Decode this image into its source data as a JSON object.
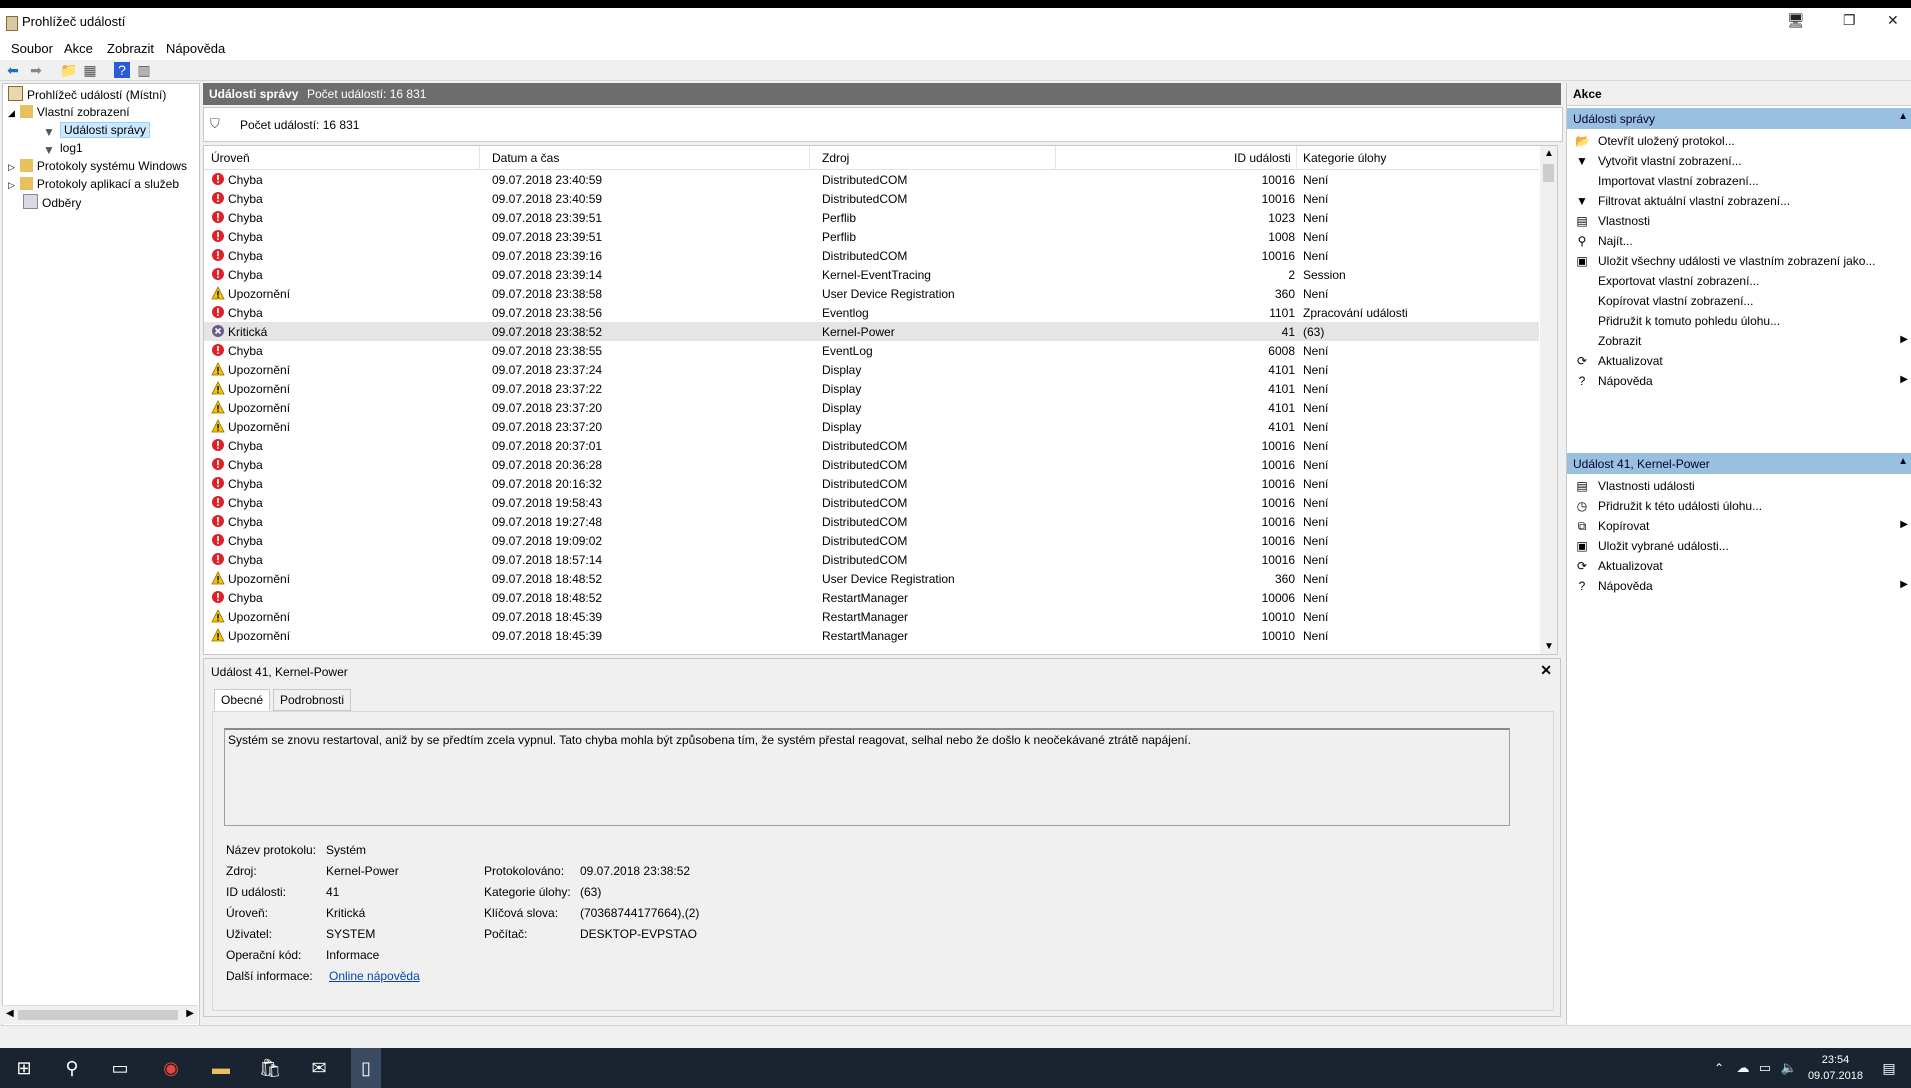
{
  "window": {
    "title": "Prohlížeč událostí"
  },
  "menu": [
    "Soubor",
    "Akce",
    "Zobrazit",
    "Nápověda"
  ],
  "tree": {
    "root": "Prohlížeč událostí (Místní)",
    "custom_views": "Vlastní zobrazení",
    "admin_events": "Události správy",
    "log1": "log1",
    "windows_logs": "Protokoly systému Windows",
    "app_logs": "Protokoly aplikací a služeb",
    "subscriptions": "Odběry"
  },
  "center_header": {
    "title": "Události správy",
    "count": "Počet událostí: 16 831"
  },
  "filter_text": "Počet událostí: 16 831",
  "columns": [
    "Úroveň",
    "Datum a čas",
    "Zdroj",
    "ID události",
    "Kategorie úlohy"
  ],
  "events": [
    {
      "level": "Chyba",
      "type": "error",
      "date": "09.07.2018 23:40:59",
      "source": "DistributedCOM",
      "id": "10016",
      "cat": "Není"
    },
    {
      "level": "Chyba",
      "type": "error",
      "date": "09.07.2018 23:40:59",
      "source": "DistributedCOM",
      "id": "10016",
      "cat": "Není"
    },
    {
      "level": "Chyba",
      "type": "error",
      "date": "09.07.2018 23:39:51",
      "source": "Perflib",
      "id": "1023",
      "cat": "Není"
    },
    {
      "level": "Chyba",
      "type": "error",
      "date": "09.07.2018 23:39:51",
      "source": "Perflib",
      "id": "1008",
      "cat": "Není"
    },
    {
      "level": "Chyba",
      "type": "error",
      "date": "09.07.2018 23:39:16",
      "source": "DistributedCOM",
      "id": "10016",
      "cat": "Není"
    },
    {
      "level": "Chyba",
      "type": "error",
      "date": "09.07.2018 23:39:14",
      "source": "Kernel-EventTracing",
      "id": "2",
      "cat": "Session"
    },
    {
      "level": "Upozornění",
      "type": "warning",
      "date": "09.07.2018 23:38:58",
      "source": "User Device Registration",
      "id": "360",
      "cat": "Není"
    },
    {
      "level": "Chyba",
      "type": "error",
      "date": "09.07.2018 23:38:56",
      "source": "Eventlog",
      "id": "1101",
      "cat": "Zpracování události"
    },
    {
      "level": "Kritická",
      "type": "critical",
      "date": "09.07.2018 23:38:52",
      "source": "Kernel-Power",
      "id": "41",
      "cat": "(63)"
    },
    {
      "level": "Chyba",
      "type": "error",
      "date": "09.07.2018 23:38:55",
      "source": "EventLog",
      "id": "6008",
      "cat": "Není"
    },
    {
      "level": "Upozornění",
      "type": "warning",
      "date": "09.07.2018 23:37:24",
      "source": "Display",
      "id": "4101",
      "cat": "Není"
    },
    {
      "level": "Upozornění",
      "type": "warning",
      "date": "09.07.2018 23:37:22",
      "source": "Display",
      "id": "4101",
      "cat": "Není"
    },
    {
      "level": "Upozornění",
      "type": "warning",
      "date": "09.07.2018 23:37:20",
      "source": "Display",
      "id": "4101",
      "cat": "Není"
    },
    {
      "level": "Upozornění",
      "type": "warning",
      "date": "09.07.2018 23:37:20",
      "source": "Display",
      "id": "4101",
      "cat": "Není"
    },
    {
      "level": "Chyba",
      "type": "error",
      "date": "09.07.2018 20:37:01",
      "source": "DistributedCOM",
      "id": "10016",
      "cat": "Není"
    },
    {
      "level": "Chyba",
      "type": "error",
      "date": "09.07.2018 20:36:28",
      "source": "DistributedCOM",
      "id": "10016",
      "cat": "Není"
    },
    {
      "level": "Chyba",
      "type": "error",
      "date": "09.07.2018 20:16:32",
      "source": "DistributedCOM",
      "id": "10016",
      "cat": "Není"
    },
    {
      "level": "Chyba",
      "type": "error",
      "date": "09.07.2018 19:58:43",
      "source": "DistributedCOM",
      "id": "10016",
      "cat": "Není"
    },
    {
      "level": "Chyba",
      "type": "error",
      "date": "09.07.2018 19:27:48",
      "source": "DistributedCOM",
      "id": "10016",
      "cat": "Není"
    },
    {
      "level": "Chyba",
      "type": "error",
      "date": "09.07.2018 19:09:02",
      "source": "DistributedCOM",
      "id": "10016",
      "cat": "Není"
    },
    {
      "level": "Chyba",
      "type": "error",
      "date": "09.07.2018 18:57:14",
      "source": "DistributedCOM",
      "id": "10016",
      "cat": "Není"
    },
    {
      "level": "Upozornění",
      "type": "warning",
      "date": "09.07.2018 18:48:52",
      "source": "User Device Registration",
      "id": "360",
      "cat": "Není"
    },
    {
      "level": "Chyba",
      "type": "error",
      "date": "09.07.2018 18:48:52",
      "source": "RestartManager",
      "id": "10006",
      "cat": "Není"
    },
    {
      "level": "Upozornění",
      "type": "warning",
      "date": "09.07.2018 18:45:39",
      "source": "RestartManager",
      "id": "10010",
      "cat": "Není"
    },
    {
      "level": "Upozornění",
      "type": "warning",
      "date": "09.07.2018 18:45:39",
      "source": "RestartManager",
      "id": "10010",
      "cat": "Není"
    }
  ],
  "detail": {
    "title": "Událost 41, Kernel-Power",
    "tabs": [
      "Obecné",
      "Podrobnosti"
    ],
    "description": "Systém se znovu restartoval, aniž by se předtím zcela vypnul. Tato chyba mohla být způsobena tím, že systém přestal reagovat, selhal nebo že došlo k neočekávané ztrátě napájení.",
    "labels": {
      "log_name": "Název protokolu:",
      "source": "Zdroj:",
      "event_id": "ID události:",
      "level": "Úroveň:",
      "user": "Uživatel:",
      "opcode": "Operační kód:",
      "more_info": "Další informace:",
      "logged": "Protokolováno:",
      "task_category": "Kategorie úlohy:",
      "keywords": "Klíčová slova:",
      "computer": "Počítač:"
    },
    "values": {
      "log_name": "Systém",
      "source": "Kernel-Power",
      "event_id": "41",
      "level": "Kritická",
      "user": "SYSTEM",
      "opcode": "Informace",
      "more_info": "Online nápověda",
      "logged": "09.07.2018 23:38:52",
      "task_category": "(63)",
      "keywords": "(70368744177664),(2)",
      "computer": "DESKTOP-EVPSTAO"
    }
  },
  "actions": {
    "header": "Akce",
    "section1": "Události správy",
    "items1": [
      {
        "label": "Otevřít uložený protokol...",
        "icon": "open-folder-icon",
        "glyph": "📂"
      },
      {
        "label": "Vytvořit vlastní zobrazení...",
        "icon": "filter-create-icon",
        "glyph": "▼"
      },
      {
        "label": "Importovat vlastní zobrazení...",
        "icon": "",
        "glyph": ""
      },
      {
        "label": "Filtrovat aktuální vlastní zobrazení...",
        "icon": "filter-icon",
        "glyph": "▼"
      },
      {
        "label": "Vlastnosti",
        "icon": "properties-icon",
        "glyph": "▤"
      },
      {
        "label": "Najít...",
        "icon": "find-icon",
        "glyph": "⚲"
      },
      {
        "label": "Uložit všechny události ve vlastním zobrazení jako...",
        "icon": "save-icon",
        "glyph": "▣"
      },
      {
        "label": "Exportovat vlastní zobrazení...",
        "icon": "",
        "glyph": ""
      },
      {
        "label": "Kopírovat vlastní zobrazení...",
        "icon": "",
        "glyph": ""
      },
      {
        "label": "Přidružit k tomuto pohledu úlohu...",
        "icon": "",
        "glyph": ""
      },
      {
        "label": "Zobrazit",
        "icon": "",
        "glyph": "",
        "arrow": true
      },
      {
        "label": "Aktualizovat",
        "icon": "refresh-icon",
        "glyph": "⟳"
      },
      {
        "label": "Nápověda",
        "icon": "help-icon",
        "glyph": "?",
        "arrow": true
      }
    ],
    "section2": "Událost 41, Kernel-Power",
    "items2": [
      {
        "label": "Vlastnosti události",
        "icon": "event-properties-icon",
        "glyph": "▤"
      },
      {
        "label": "Přidružit k této události úlohu...",
        "icon": "task-icon",
        "glyph": "◷"
      },
      {
        "label": "Kopírovat",
        "icon": "copy-icon",
        "glyph": "⧉",
        "arrow": true
      },
      {
        "label": "Uložit vybrané události...",
        "icon": "save-icon",
        "glyph": "▣"
      },
      {
        "label": "Aktualizovat",
        "icon": "refresh-icon",
        "glyph": "⟳"
      },
      {
        "label": "Nápověda",
        "icon": "help-icon",
        "glyph": "?",
        "arrow": true
      }
    ]
  },
  "clock": {
    "time": "23:54",
    "date": "09.07.2018"
  },
  "colors": {
    "error": "#d9222a",
    "warning": "#f5c400",
    "critical": "#6a5a8a",
    "section": "#9ac0e0",
    "header": "#6d6d6d"
  }
}
